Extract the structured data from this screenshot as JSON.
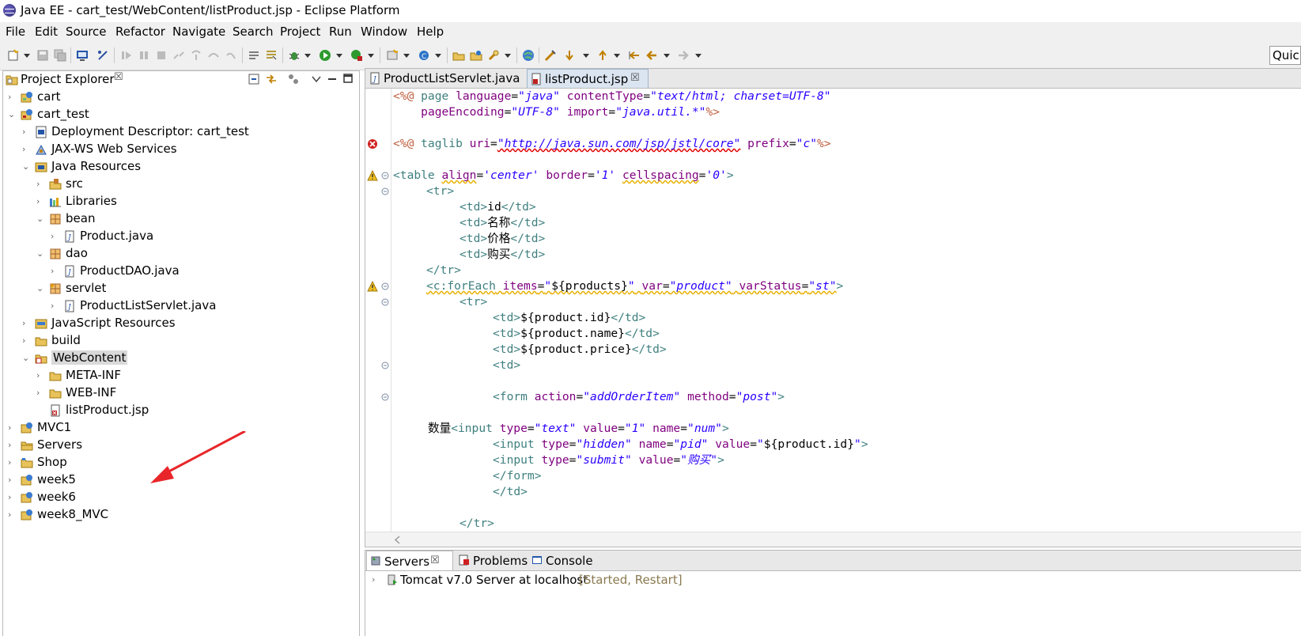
{
  "window": {
    "title": "Java EE - cart_test/WebContent/listProduct.jsp - Eclipse Platform"
  },
  "menu": [
    "File",
    "Edit",
    "Source",
    "Refactor",
    "Navigate",
    "Search",
    "Project",
    "Run",
    "Window",
    "Help"
  ],
  "quick_access": "Quic",
  "explorer": {
    "title": "Project Explorer",
    "close": "☒",
    "items": [
      {
        "label": "cart"
      },
      {
        "label": "cart_test"
      },
      {
        "label": "Deployment Descriptor: cart_test"
      },
      {
        "label": "JAX-WS Web Services"
      },
      {
        "label": "Java Resources"
      },
      {
        "label": "src"
      },
      {
        "label": "Libraries"
      },
      {
        "label": "bean"
      },
      {
        "label": "Product.java"
      },
      {
        "label": "dao"
      },
      {
        "label": "ProductDAO.java"
      },
      {
        "label": "servlet"
      },
      {
        "label": "ProductListServlet.java"
      },
      {
        "label": "JavaScript Resources"
      },
      {
        "label": "build"
      },
      {
        "label": "WebContent"
      },
      {
        "label": "META-INF"
      },
      {
        "label": "WEB-INF"
      },
      {
        "label": "listProduct.jsp"
      },
      {
        "label": "MVC1"
      },
      {
        "label": "Servers"
      },
      {
        "label": "Shop"
      },
      {
        "label": "week5"
      },
      {
        "label": "week6"
      },
      {
        "label": "week8_MVC"
      }
    ]
  },
  "editor": {
    "tabs": [
      {
        "label": "ProductListServlet.java"
      },
      {
        "label": "listProduct.jsp",
        "close": "☒"
      }
    ],
    "code": {
      "l1": [
        "<%@",
        " page ",
        "language",
        "=",
        "\"java\"",
        " ",
        "contentType",
        "=",
        "\"text/html; charset=UTF-8\""
      ],
      "l2": [
        "    ",
        "pageEncoding",
        "=",
        "\"UTF-8\"",
        " ",
        "import",
        "=",
        "\"java.util.*\"",
        "%>"
      ],
      "l3": [
        "<%@",
        " taglib ",
        "uri",
        "=",
        "\"http://java.sun.com/jsp/jstl/core\"",
        " ",
        "prefix",
        "=",
        "\"c\"",
        "%>"
      ],
      "l4": [
        "<table",
        " ",
        "align",
        "=",
        "'center'",
        " ",
        "border",
        "=",
        "'1'",
        " ",
        "cellspacing",
        "=",
        "'0'",
        ">"
      ],
      "l5": "<tr>",
      "l6": [
        "<td>",
        "id",
        "</td>"
      ],
      "l7": [
        "<td>",
        "名称",
        "</td>"
      ],
      "l8": [
        "<td>",
        "价格",
        "</td>"
      ],
      "l9": [
        "<td>",
        "购买",
        "</td>"
      ],
      "l10": "</tr>",
      "l11": [
        "<c:forEach",
        " ",
        "items",
        "=",
        "\"",
        "${products}",
        "\"",
        " ",
        "var",
        "=",
        "\"product\"",
        " ",
        "varStatus",
        "=",
        "\"st\"",
        ">"
      ],
      "l12": "<tr>",
      "l13": [
        "<td>",
        "${product.id}",
        "</td>"
      ],
      "l14": [
        "<td>",
        "${product.name}",
        "</td>"
      ],
      "l15": [
        "<td>",
        "${product.price}",
        "</td>"
      ],
      "l16": "<td>",
      "l17": [
        "<form",
        " ",
        "action",
        "=",
        "\"addOrderItem\"",
        " ",
        "method",
        "=",
        "\"post\"",
        ">"
      ],
      "l18": [
        "数量",
        "<input",
        " ",
        "type",
        "=",
        "\"text\"",
        " ",
        "value",
        "=",
        "\"1\"",
        " ",
        "name",
        "=",
        "\"num\"",
        ">"
      ],
      "l19": [
        "<input",
        " ",
        "type",
        "=",
        "\"hidden\"",
        " ",
        "name",
        "=",
        "\"pid\"",
        " ",
        "value",
        "=",
        "\"",
        "${product.id}",
        "\"",
        ">"
      ],
      "l20": [
        "<input",
        " ",
        "type",
        "=",
        "\"submit\"",
        " ",
        "value",
        "=",
        "\"购买\"",
        ">"
      ],
      "l21": "</form>",
      "l22": "</td>",
      "l23": "</tr>"
    }
  },
  "bottom": {
    "tabs": [
      {
        "label": "Servers",
        "close": "☒"
      },
      {
        "label": "Problems"
      },
      {
        "label": "Console"
      }
    ],
    "server": {
      "name": "Tomcat v7.0 Server at localhost",
      "status": "[Started, Restart]"
    }
  },
  "colors": {
    "tag": "#3f7f7f",
    "attr": "#7f007f",
    "value": "#2a00ff",
    "directive": "#bf5f3f",
    "annotation_arrow": "#e8262a"
  }
}
